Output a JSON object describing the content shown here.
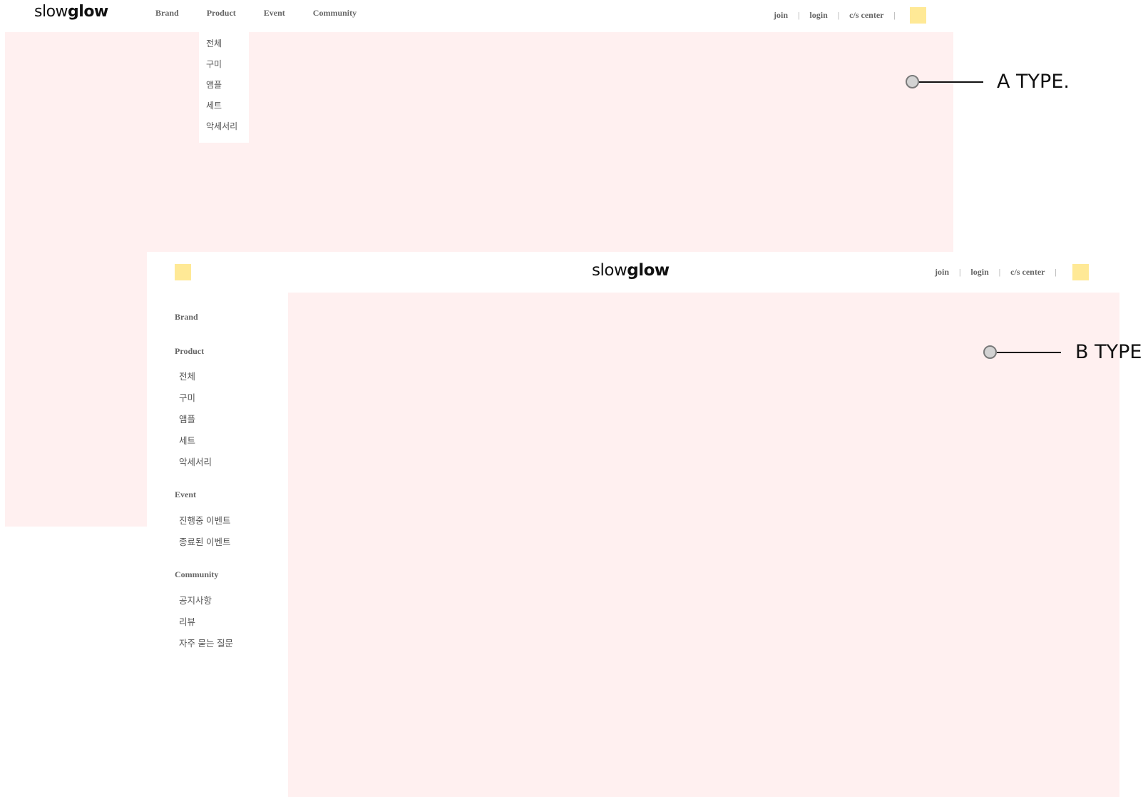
{
  "a_type": {
    "logo": {
      "thin": "slow",
      "bold": "glow"
    },
    "nav": [
      "Brand",
      "Product",
      "Event",
      "Community"
    ],
    "util": {
      "join": "join",
      "login": "login",
      "cs": "c/s center",
      "sep": "|"
    },
    "product_dropdown": [
      "전체",
      "구미",
      "앰플",
      "세트",
      "악세서리"
    ],
    "label": "A TYPE."
  },
  "b_type": {
    "logo": {
      "thin": "slow",
      "bold": "glow"
    },
    "util": {
      "join": "join",
      "login": "login",
      "cs": "c/s center",
      "sep": "|"
    },
    "sidebar": {
      "brand": "Brand",
      "product": "Product",
      "product_items": [
        "전체",
        "구미",
        "앰플",
        "세트",
        "악세서리"
      ],
      "event": "Event",
      "event_items": [
        "진행중 이벤트",
        "종료된 이벤트"
      ],
      "community": "Community",
      "community_items": [
        "공지사항",
        "리뷰",
        "자주 묻는 질문"
      ]
    },
    "label": "B TYPE."
  },
  "colors": {
    "content_bg": "#fff0f0",
    "placeholder_square": "#ffe996",
    "text": "#666666"
  },
  "icons": [
    "annotation-dot-icon",
    "placeholder-square-icon"
  ]
}
